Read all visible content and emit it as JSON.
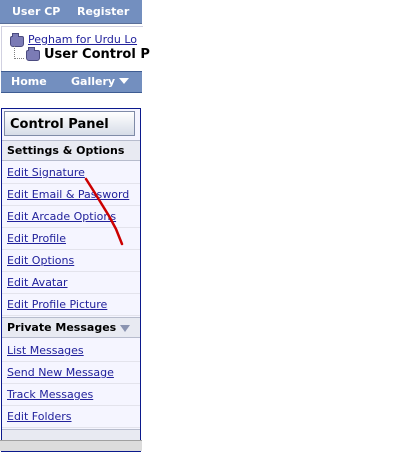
{
  "top_nav": {
    "user_cp": "User CP",
    "register": "Register"
  },
  "breadcrumb": {
    "forum_link": "Pegham for Urdu Lo",
    "current_page": "User Control P"
  },
  "navbar": {
    "home": "Home",
    "gallery": "Gallery"
  },
  "panel": {
    "title": "Control Panel",
    "settings_section": "Settings & Options",
    "settings_items": [
      "Edit Signature",
      "Edit Email & Password",
      "Edit Arcade Options",
      "Edit Profile",
      "Edit Options",
      "Edit Avatar",
      "Edit Profile Picture"
    ],
    "pm_section": "Private Messages",
    "pm_items": [
      "List Messages",
      "Send New Message",
      "Track Messages",
      "Edit Folders"
    ]
  },
  "colors": {
    "nav_bg": "#738fbf",
    "link": "#22229c",
    "annotation": "#cc0000"
  }
}
